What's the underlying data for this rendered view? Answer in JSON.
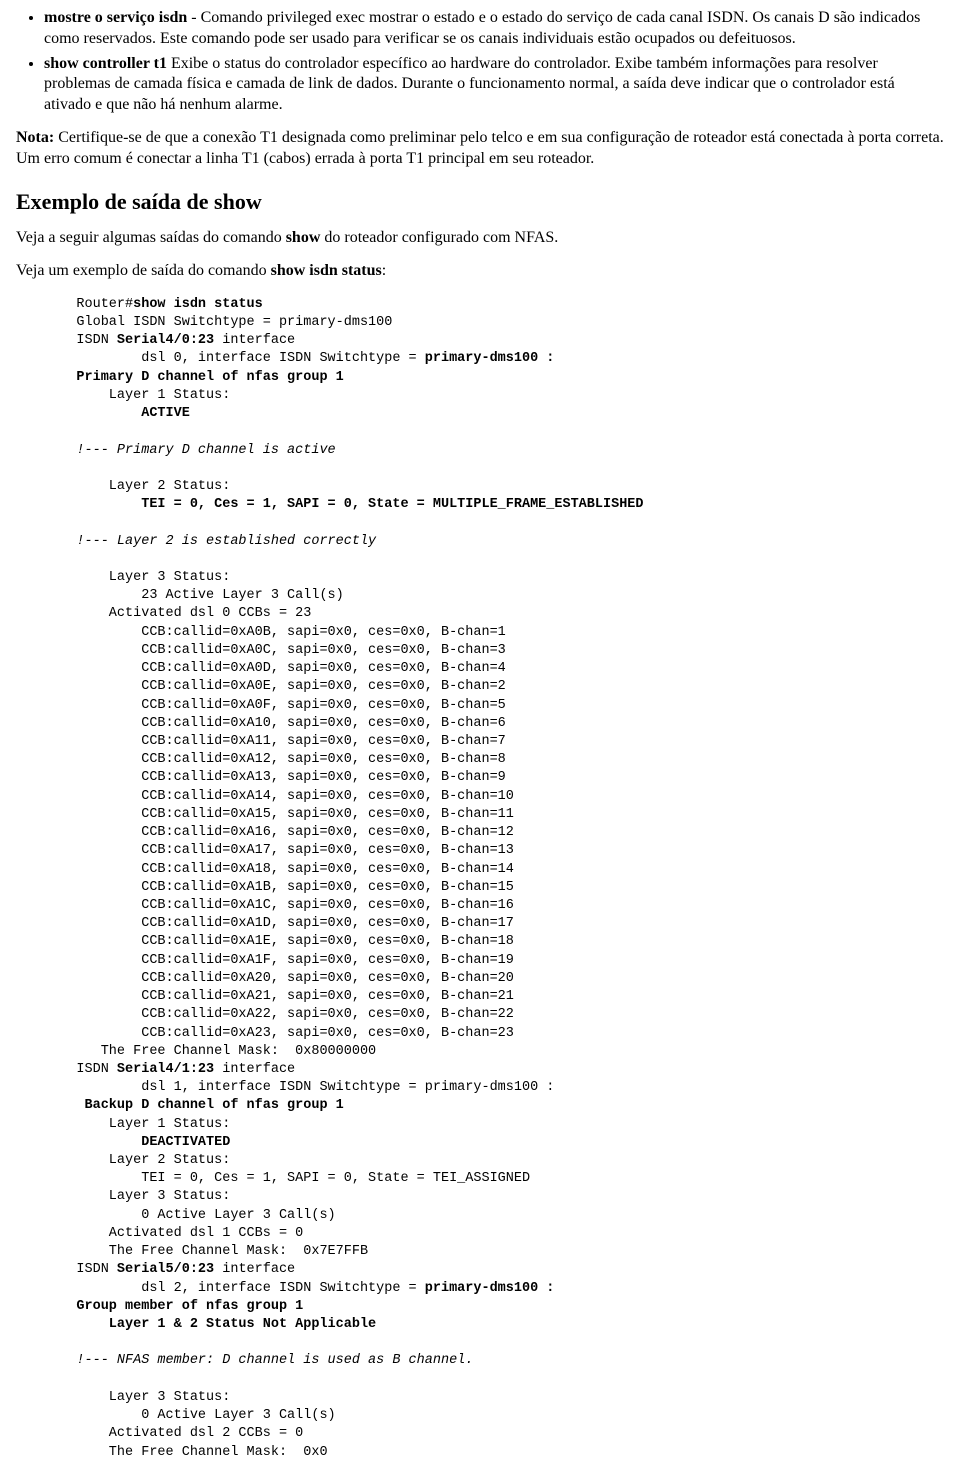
{
  "bullet1": {
    "bold": "mostre o serviço isdn",
    "text": " - Comando privileged exec mostrar o estado e o estado do serviço de cada canal ISDN. Os canais D são indicados como reservados. Este comando pode ser usado para verificar se os canais individuais estão ocupados ou defeituosos."
  },
  "bullet2": {
    "bold": "show controller t1",
    "text": " Exibe o status do controlador específico ao hardware do controlador. Exibe também informações para resolver problemas de camada física e camada de link de dados. Durante o funcionamento normal, a saída deve indicar que o controlador está ativado e que não há nenhum alarme."
  },
  "note": {
    "bold": "Nota:",
    "text": " Certifique-se de que a conexão T1 designada como preliminar pelo telco e em sua configuração de roteador está conectada à porta correta. Um erro comum é conectar a linha T1 (cabos) errada à porta T1 principal em seu roteador."
  },
  "heading": "Exemplo de saída de show",
  "para1": {
    "pre": "Veja a seguir algumas saídas do comando ",
    "bold": "show",
    "post": " do roteador configurado com NFAS."
  },
  "para2": {
    "pre": "Veja um exemplo de saída do comando ",
    "bold": "show isdn status",
    "post": ":"
  },
  "code": {
    "l01a": "    Router#",
    "l01b": "show isdn status",
    "l02": "    Global ISDN Switchtype = primary-dms100",
    "l03a": "    ISDN ",
    "l03b": "Serial4/0:23",
    "l03c": " interface",
    "l04a": "            dsl 0, interface ISDN Switchtype = ",
    "l04b": "primary-dms100 :",
    "l05": "    Primary D channel of nfas group 1",
    "l06": "        Layer 1 Status:",
    "l07": "            ACTIVE",
    "l08": "",
    "l09": "    !--- Primary D channel is active",
    "l10": "",
    "l11": "        Layer 2 Status:",
    "l12": "            TEI = 0, Ces = 1, SAPI = 0, State = MULTIPLE_FRAME_ESTABLISHED",
    "l13": "",
    "l14": "    !--- Layer 2 is established correctly",
    "l15": "",
    "l16": "        Layer 3 Status:",
    "l17": "            23 Active Layer 3 Call(s)",
    "l18": "        Activated dsl 0 CCBs = 23",
    "l19": "            CCB:callid=0xA0B, sapi=0x0, ces=0x0, B-chan=1",
    "l20": "            CCB:callid=0xA0C, sapi=0x0, ces=0x0, B-chan=3",
    "l21": "            CCB:callid=0xA0D, sapi=0x0, ces=0x0, B-chan=4",
    "l22": "            CCB:callid=0xA0E, sapi=0x0, ces=0x0, B-chan=2",
    "l23": "            CCB:callid=0xA0F, sapi=0x0, ces=0x0, B-chan=5",
    "l24": "            CCB:callid=0xA10, sapi=0x0, ces=0x0, B-chan=6",
    "l25": "            CCB:callid=0xA11, sapi=0x0, ces=0x0, B-chan=7",
    "l26": "            CCB:callid=0xA12, sapi=0x0, ces=0x0, B-chan=8",
    "l27": "            CCB:callid=0xA13, sapi=0x0, ces=0x0, B-chan=9",
    "l28": "            CCB:callid=0xA14, sapi=0x0, ces=0x0, B-chan=10",
    "l29": "            CCB:callid=0xA15, sapi=0x0, ces=0x0, B-chan=11",
    "l30": "            CCB:callid=0xA16, sapi=0x0, ces=0x0, B-chan=12",
    "l31": "            CCB:callid=0xA17, sapi=0x0, ces=0x0, B-chan=13",
    "l32": "            CCB:callid=0xA18, sapi=0x0, ces=0x0, B-chan=14",
    "l33": "            CCB:callid=0xA1B, sapi=0x0, ces=0x0, B-chan=15",
    "l34": "            CCB:callid=0xA1C, sapi=0x0, ces=0x0, B-chan=16",
    "l35": "            CCB:callid=0xA1D, sapi=0x0, ces=0x0, B-chan=17",
    "l36": "            CCB:callid=0xA1E, sapi=0x0, ces=0x0, B-chan=18",
    "l37": "            CCB:callid=0xA1F, sapi=0x0, ces=0x0, B-chan=19",
    "l38": "            CCB:callid=0xA20, sapi=0x0, ces=0x0, B-chan=20",
    "l39": "            CCB:callid=0xA21, sapi=0x0, ces=0x0, B-chan=21",
    "l40": "            CCB:callid=0xA22, sapi=0x0, ces=0x0, B-chan=22",
    "l41": "            CCB:callid=0xA23, sapi=0x0, ces=0x0, B-chan=23",
    "l42": "       The Free Channel Mask:  0x80000000",
    "l43a": "    ISDN ",
    "l43b": "Serial4/1:23",
    "l43c": " interface",
    "l44": "            dsl 1, interface ISDN Switchtype = primary-dms100 :",
    "l45": "     Backup D channel of nfas group 1",
    "l46": "        Layer 1 Status:",
    "l47": "            DEACTIVATED",
    "l48": "        Layer 2 Status:",
    "l49": "            TEI = 0, Ces = 1, SAPI = 0, State = TEI_ASSIGNED",
    "l50": "        Layer 3 Status:",
    "l51": "            0 Active Layer 3 Call(s)",
    "l52": "        Activated dsl 1 CCBs = 0",
    "l53": "        The Free Channel Mask:  0x7E7FFB",
    "l54a": "    ISDN ",
    "l54b": "Serial5/0:23",
    "l54c": " interface",
    "l55a": "            dsl 2, interface ISDN Switchtype = ",
    "l55b": "primary-dms100 :",
    "l56": "    Group member of nfas group 1",
    "l57": "        Layer 1 & 2 Status Not Applicable",
    "l58": "",
    "l59": "    !--- NFAS member: D channel is used as B channel.",
    "l60": "",
    "l61": "        Layer 3 Status:",
    "l62": "            0 Active Layer 3 Call(s)",
    "l63": "        Activated dsl 2 CCBs = 0",
    "l64": "        The Free Channel Mask:  0x0"
  }
}
